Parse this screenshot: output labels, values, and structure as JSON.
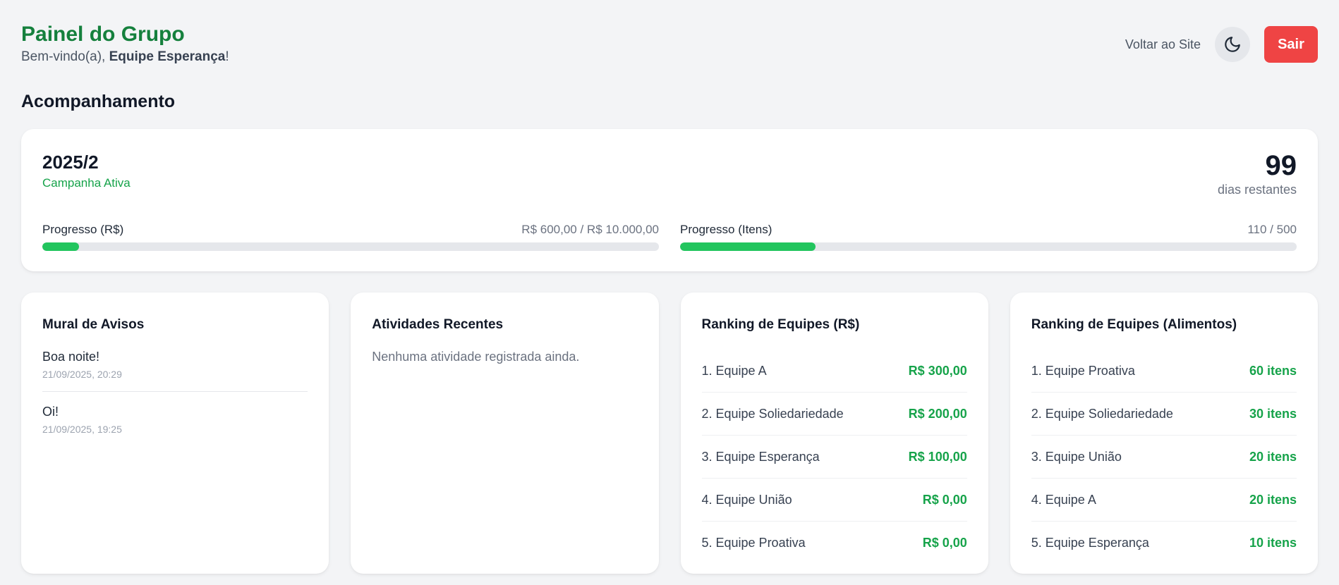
{
  "header": {
    "title": "Painel do Grupo",
    "welcome_prefix": "Bem-vindo(a), ",
    "team_name": "Equipe Esperança",
    "welcome_suffix": "!",
    "back_label": "Voltar ao Site",
    "theme_icon": "moon-icon",
    "logout_label": "Sair"
  },
  "section_title": "Acompanhamento",
  "campaign": {
    "period": "2025/2",
    "status": "Campanha Ativa",
    "days_remaining": "99",
    "days_label": "dias restantes",
    "progress_money": {
      "label": "Progresso (R$)",
      "value_text": "R$ 600,00 / R$ 10.000,00",
      "fraction": 0.06
    },
    "progress_items": {
      "label": "Progresso (Itens)",
      "value_text": "110 / 500",
      "fraction": 0.22
    },
    "accent_color": "#22c55e"
  },
  "notices": {
    "title": "Mural de Avisos",
    "items": [
      {
        "text": "Boa noite!",
        "time": "21/09/2025, 20:29"
      },
      {
        "text": "Oi!",
        "time": "21/09/2025, 19:25"
      }
    ]
  },
  "activities": {
    "title": "Atividades Recentes",
    "empty_text": "Nenhuma atividade registrada ainda."
  },
  "ranking_money": {
    "title": "Ranking de Equipes (R$)",
    "rows": [
      {
        "name": "1. Equipe A",
        "value": "R$ 300,00"
      },
      {
        "name": "2. Equipe Soliedariedade",
        "value": "R$ 200,00"
      },
      {
        "name": "3. Equipe Esperança",
        "value": "R$ 100,00"
      },
      {
        "name": "4. Equipe União",
        "value": "R$ 0,00"
      },
      {
        "name": "5. Equipe Proativa",
        "value": "R$ 0,00"
      }
    ]
  },
  "ranking_food": {
    "title": "Ranking de Equipes (Alimentos)",
    "rows": [
      {
        "name": "1. Equipe Proativa",
        "value": "60 itens"
      },
      {
        "name": "2. Equipe Soliedariedade",
        "value": "30 itens"
      },
      {
        "name": "3. Equipe União",
        "value": "20 itens"
      },
      {
        "name": "4. Equipe A",
        "value": "20 itens"
      },
      {
        "name": "5. Equipe Esperança",
        "value": "10 itens"
      }
    ]
  },
  "colors": {
    "title_green": "#15803d",
    "value_green": "#16a34a",
    "logout_red": "#ef4444"
  }
}
